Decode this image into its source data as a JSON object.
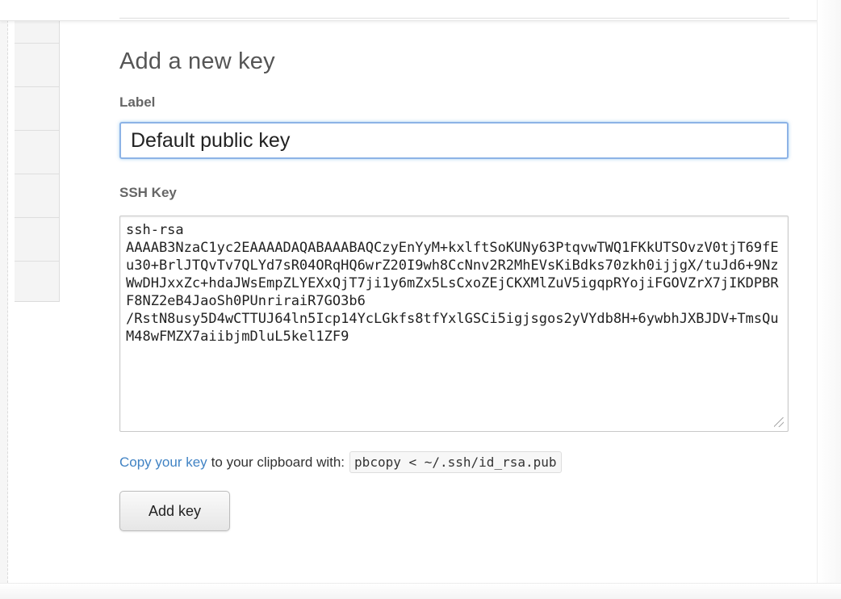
{
  "form": {
    "title": "Add a new key",
    "label_field": {
      "label": "Label",
      "value": "Default public key"
    },
    "ssh_field": {
      "label": "SSH Key",
      "value": "ssh-rsa\nAAAAB3NzaC1yc2EAAAADAQABAAABAQCzyEnYyM+kxlftSoKUNy63PtqvwTWQ1FKkUTSOvzV0tjT69fEu30+BrlJTQvTv7QLYd7sR04ORqHQ6wrZ20I9wh8CcNnv2R2MhEVsKiBdks70zkh0ijjgX/tuJd6+9NzWwDHJxxZc+hdaJWsEmpZLYEXxQjT7ji1y6mZx5LsCxoZEjCKXMlZuV5igqpRYojiFGOVZrX7jIKDPBRF8NZ2eB4JaoSh0PUnriraiR7GO3b6\n/RstN8usy5D4wCTTUJ64ln5Icp14YcLGkfs8tfYxlGSCi5igjsgos2yVYdb8H+6ywbhJXBJDV+TmsQuM48wFMZX7aiibjmDluL5kel1ZF9"
    },
    "copy_hint": {
      "link_text": "Copy your key",
      "text": "to your clipboard with:",
      "command": "pbcopy < ~/.ssh/id_rsa.pub"
    },
    "submit_label": "Add key"
  }
}
